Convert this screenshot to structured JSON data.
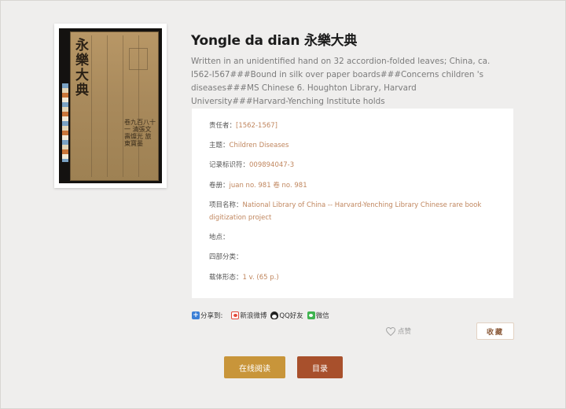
{
  "title": "Yongle da dian 永樂大典",
  "description": "Written in an unidentified hand on 32 accordion-folded leaves; China, ca. I562-I567###Bound in silk over paper boards###Concerns children  's diseases###MS Chinese 6. Houghton Library, Harvard University###Harvard-Yenching Institute holds",
  "cover": {
    "title": "永樂大典",
    "text": "卷九百八十一 清張文 壽燦光 旅東寶墨"
  },
  "info": {
    "responsible": {
      "label": "责任者：",
      "value": "[1562-1567]"
    },
    "subject": {
      "label": "主题：",
      "value": "Children Diseases"
    },
    "record_id": {
      "label": "记录标识符：",
      "value": "009894047-3"
    },
    "volume": {
      "label": "卷册：",
      "value": "juan no. 981 卷 no. 981"
    },
    "project": {
      "label": "项目名称：",
      "value": "National Library of China -- Harvard-Yenching Library Chinese rare book digitization project"
    },
    "location": {
      "label": "地点：",
      "value": ""
    },
    "classification": {
      "label": "四部分类：",
      "value": ""
    },
    "form": {
      "label": "载体形态：",
      "value": "1 v. (65 p.)"
    }
  },
  "share": {
    "label": "分享到:",
    "weibo": "新浪微博",
    "qq": "QQ好友",
    "wechat": "微信"
  },
  "like_label": "点赞",
  "favorite_label": "收藏",
  "read_online_label": "在线阅读",
  "toc_label": "目录",
  "colors": {
    "accent_link": "#c0865e",
    "read_button": "#c8953a",
    "toc_button": "#a8502c"
  }
}
